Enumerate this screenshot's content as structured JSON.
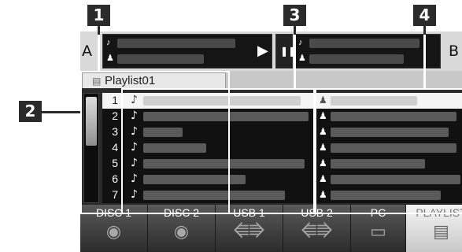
{
  "callouts": [
    "1",
    "2",
    "3",
    "4"
  ],
  "now_playing": {
    "left_letter": "A",
    "right_letter": "B"
  },
  "playlist_tab": {
    "label": "Playlist01"
  },
  "track_list": {
    "rows": [
      {
        "number": "1",
        "selected": true
      },
      {
        "number": "2",
        "selected": false
      },
      {
        "number": "3",
        "selected": false
      },
      {
        "number": "4",
        "selected": false
      },
      {
        "number": "5",
        "selected": false
      },
      {
        "number": "6",
        "selected": false
      },
      {
        "number": "7",
        "selected": false
      }
    ]
  },
  "sources": [
    {
      "label": "DISC 1",
      "icon": "disc-icon"
    },
    {
      "label": "DISC 2",
      "icon": "disc-icon"
    },
    {
      "label": "USB 1",
      "icon": "usb-icon"
    },
    {
      "label": "USB 2",
      "icon": "usb-icon"
    },
    {
      "label": "PC",
      "icon": "pc-icon"
    },
    {
      "label": "PLAYLIST",
      "icon": "list-icon",
      "active": true
    }
  ]
}
